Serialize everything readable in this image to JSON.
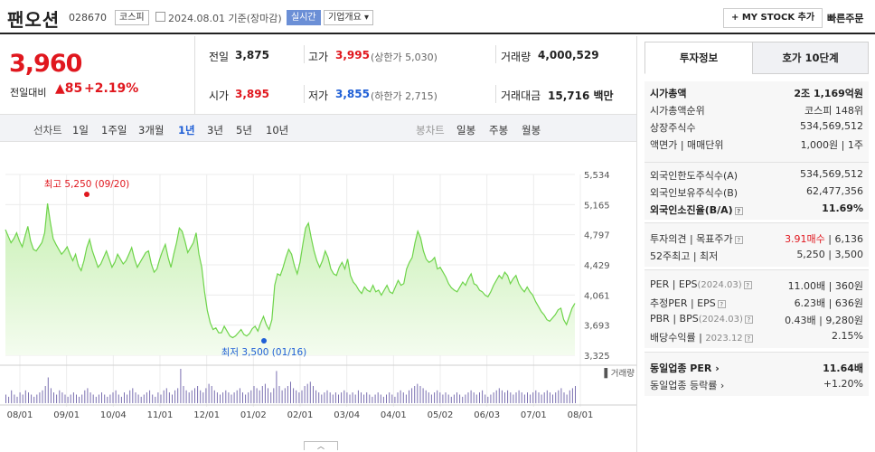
{
  "header": {
    "name": "팬오션",
    "code": "028670",
    "market": "코스피",
    "date": "2024.08.01",
    "basis": "기준(장마감)",
    "realtime": "실시간",
    "company_info": "기업개요 ▾",
    "mystock": "+ MY STOCK 추가",
    "quick_order": "빠른주문"
  },
  "price": {
    "current": "3,960",
    "change_label": "전일대비",
    "change": "▲85",
    "change_pct": "+2.19%"
  },
  "summary": {
    "prev_k": "전일",
    "prev_v": "3,875",
    "high_k": "고가",
    "high_v": "3,995",
    "upper_limit": "(상한가 5,030)",
    "volume_k": "거래량",
    "volume_v": "4,000,529",
    "open_k": "시가",
    "open_v": "3,895",
    "low_k": "저가",
    "low_v": "3,855",
    "lower_limit": "(하한가 2,715)",
    "amount_k": "거래대금",
    "amount_v": "15,716",
    "amount_unit": "백만"
  },
  "tabs": {
    "line_label": "선차트",
    "periods": [
      "1일",
      "1주일",
      "3개월",
      "1년",
      "3년",
      "5년",
      "10년"
    ],
    "active": "1년",
    "candle_label": "봉차트",
    "candle_periods": [
      "일봉",
      "주봉",
      "월봉"
    ]
  },
  "chart_data": {
    "type": "area",
    "y_ticks": [
      "5,534",
      "5,165",
      "4,797",
      "4,429",
      "4,061",
      "3,693",
      "3,325"
    ],
    "ylim": [
      3325,
      5534
    ],
    "x_ticks": [
      "08/01",
      "09/01",
      "10/04",
      "11/01",
      "12/01",
      "01/02",
      "02/01",
      "03/04",
      "04/01",
      "05/02",
      "06/03",
      "07/01",
      "08/01"
    ],
    "max_label": "최고 5,250 (09/20)",
    "min_label": "최저 3,500 (01/16)",
    "volume_label": "거래량",
    "values": [
      4860,
      4780,
      4700,
      4750,
      4820,
      4720,
      4650,
      4780,
      4900,
      4720,
      4620,
      4600,
      4650,
      4700,
      4820,
      5180,
      4950,
      4750,
      4680,
      4620,
      4560,
      4600,
      4650,
      4560,
      4480,
      4560,
      4420,
      4360,
      4480,
      4640,
      4740,
      4600,
      4500,
      4400,
      4440,
      4520,
      4600,
      4500,
      4400,
      4460,
      4560,
      4500,
      4440,
      4480,
      4560,
      4640,
      4500,
      4400,
      4460,
      4520,
      4580,
      4600,
      4440,
      4340,
      4380,
      4500,
      4600,
      4680,
      4520,
      4400,
      4560,
      4700,
      4880,
      4840,
      4720,
      4580,
      4640,
      4700,
      4820,
      4560,
      4400,
      4100,
      3870,
      3720,
      3640,
      3660,
      3600,
      3600,
      3680,
      3620,
      3560,
      3540,
      3560,
      3600,
      3640,
      3580,
      3560,
      3590,
      3650,
      3680,
      3620,
      3720,
      3800,
      3700,
      3640,
      3760,
      4180,
      4320,
      4300,
      4400,
      4520,
      4620,
      4560,
      4420,
      4320,
      4460,
      4680,
      4880,
      4940,
      4760,
      4600,
      4480,
      4400,
      4480,
      4600,
      4520,
      4380,
      4320,
      4300,
      4400,
      4460,
      4380,
      4500,
      4300,
      4220,
      4180,
      4120,
      4080,
      4160,
      4120,
      4100,
      4180,
      4100,
      4120,
      4060,
      4120,
      4180,
      4100,
      4080,
      4160,
      4240,
      4180,
      4200,
      4380,
      4460,
      4520,
      4700,
      4840,
      4760,
      4600,
      4500,
      4460,
      4480,
      4520,
      4380,
      4400,
      4340,
      4280,
      4200,
      4150,
      4120,
      4100,
      4160,
      4220,
      4180,
      4260,
      4320,
      4200,
      4180,
      4120,
      4100,
      4060,
      4040,
      4100,
      4180,
      4240,
      4300,
      4260,
      4340,
      4300,
      4200,
      4260,
      4300,
      4200,
      4140,
      4100,
      4160,
      4100,
      4060,
      3980,
      3920,
      3860,
      3820,
      3760,
      3740,
      3780,
      3820,
      3880,
      3900,
      3760,
      3700,
      3800,
      3900,
      3960
    ],
    "volumes": [
      4,
      3,
      6,
      4,
      3,
      5,
      4,
      6,
      5,
      4,
      3,
      4,
      5,
      6,
      8,
      12,
      7,
      5,
      4,
      6,
      5,
      4,
      3,
      4,
      5,
      4,
      3,
      4,
      6,
      7,
      5,
      4,
      3,
      4,
      5,
      4,
      3,
      4,
      5,
      6,
      4,
      3,
      5,
      4,
      6,
      7,
      5,
      4,
      3,
      4,
      5,
      6,
      4,
      3,
      5,
      4,
      6,
      7,
      5,
      4,
      6,
      7,
      16,
      8,
      6,
      5,
      6,
      7,
      8,
      6,
      5,
      7,
      9,
      8,
      6,
      5,
      4,
      5,
      6,
      5,
      4,
      5,
      6,
      7,
      5,
      4,
      5,
      6,
      8,
      7,
      6,
      8,
      9,
      7,
      5,
      7,
      15,
      8,
      6,
      7,
      8,
      10,
      7,
      6,
      5,
      6,
      8,
      9,
      10,
      8,
      6,
      5,
      4,
      5,
      6,
      5,
      4,
      5,
      4,
      5,
      6,
      5,
      4,
      5,
      4,
      6,
      5,
      4,
      5,
      4,
      3,
      4,
      5,
      4,
      3,
      4,
      5,
      4,
      3,
      5,
      6,
      5,
      4,
      6,
      7,
      8,
      9,
      8,
      7,
      6,
      5,
      4,
      5,
      6,
      5,
      4,
      5,
      4,
      3,
      4,
      5,
      4,
      3,
      4,
      5,
      6,
      5,
      4,
      5,
      6,
      4,
      3,
      4,
      5,
      6,
      7,
      6,
      5,
      6,
      5,
      4,
      5,
      6,
      5,
      4,
      5,
      4,
      5,
      6,
      5,
      4,
      5,
      6,
      5,
      4,
      5,
      6,
      7,
      5,
      4,
      6,
      7,
      8
    ],
    "line_color": "#6ed44a",
    "fill_color": "#c8f0b4"
  },
  "right_panel": {
    "tab_active": "투자정보",
    "tab_other": "호가 10단계",
    "market_cap_k": "시가총액",
    "market_cap_v": "2조 1,169억원",
    "rank_k": "시가총액순위",
    "rank_v": "코스피 148위",
    "shares_k": "상장주식수",
    "shares_v": "534,569,512",
    "par_k": "액면가 | 매매단위",
    "par_v": "1,000원 | 1주",
    "foreign_limit_k": "외국인한도주식수(A)",
    "foreign_limit_v": "534,569,512",
    "foreign_hold_k": "외국인보유주식수(B)",
    "foreign_hold_v": "62,477,356",
    "foreign_ratio_k": "외국인소진율(B/A)",
    "foreign_ratio_v": "11.69%",
    "opinion_k": "투자의견 | 목표주가",
    "opinion_v": "3.91매수",
    "target_v": "6,136",
    "week52_k": "52주최고 | 최저",
    "week52_v": "5,250 | 3,500",
    "per_k": "PER | EPS",
    "per_date": "(2024.03)",
    "per_v": "11.00배 | 360원",
    "est_per_k": "추정PER | EPS",
    "est_per_v": "6.23배 | 636원",
    "pbr_k": "PBR | BPS",
    "pbr_date": "(2024.03)",
    "pbr_v": "0.43배 | 9,280원",
    "div_k": "배당수익률",
    "div_date": "2023.12",
    "div_v": "2.15%",
    "sector_per_k": "동일업종 PER",
    "sector_per_v": "11.64배",
    "sector_rate_k": "동일업종 등락률",
    "sector_rate_v": "+1.20%"
  }
}
